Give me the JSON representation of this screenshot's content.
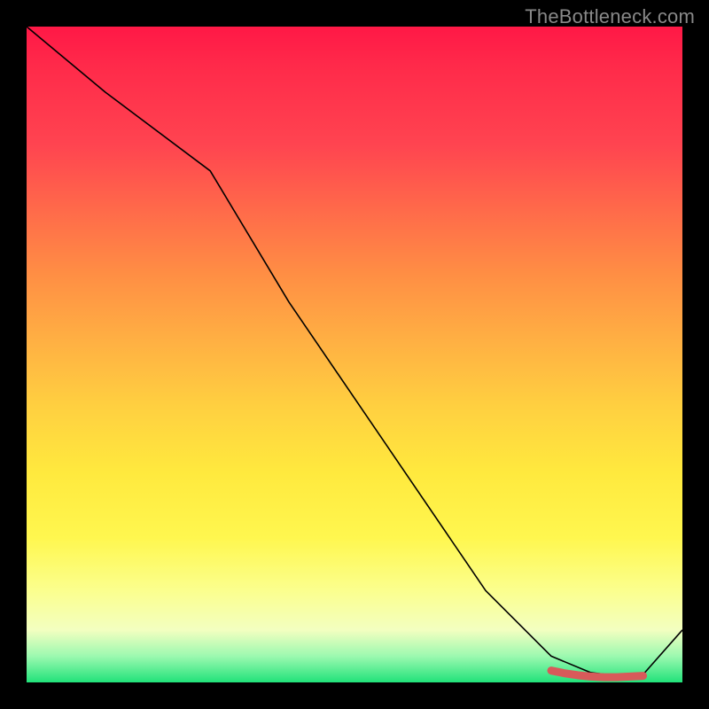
{
  "watermark": "TheBottleneck.com",
  "chart_data": {
    "type": "line",
    "title": "",
    "xlabel": "",
    "ylabel": "",
    "xlim": [
      0,
      100
    ],
    "ylim": [
      0,
      100
    ],
    "grid": false,
    "legend": false,
    "series": [
      {
        "name": "curve",
        "color": "#000000",
        "x": [
          0,
          12,
          28,
          40,
          55,
          70,
          80,
          86,
          90,
          94,
          100
        ],
        "y": [
          100,
          90,
          78,
          58,
          36,
          14,
          4,
          1.5,
          1,
          1.2,
          8
        ]
      }
    ],
    "markers": {
      "name": "highlight-band",
      "color": "#d85a5a",
      "x": [
        80,
        82,
        84,
        86,
        88,
        90,
        92,
        94
      ],
      "y": [
        1.8,
        1.4,
        1.1,
        0.9,
        0.8,
        0.8,
        0.9,
        1.0
      ]
    },
    "background_gradient": {
      "top": "#ff1846",
      "mid": "#ffe93e",
      "bottom": "#21e27a"
    }
  }
}
